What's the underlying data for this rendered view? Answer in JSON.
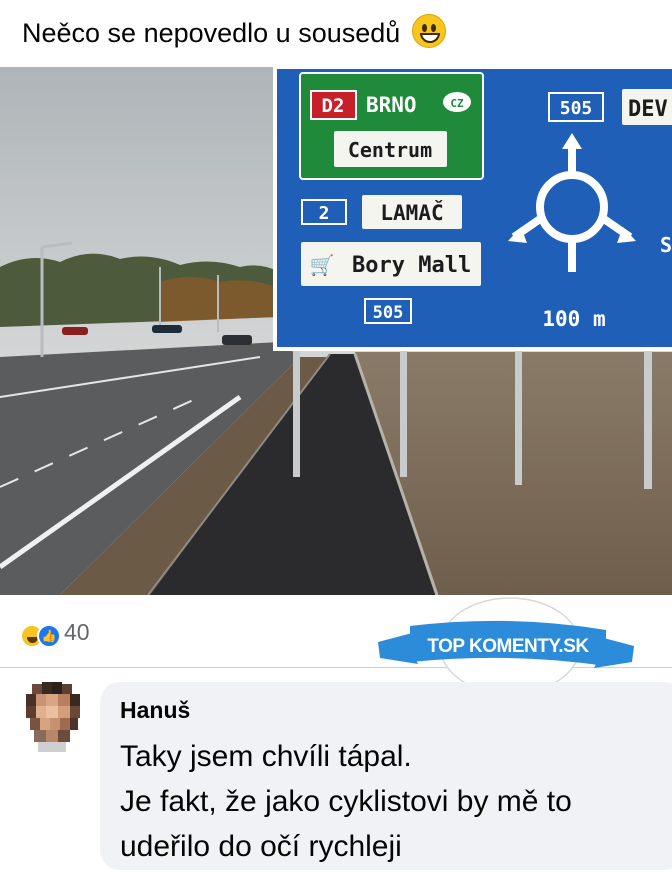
{
  "post": {
    "text": "Neěco se nepovedlo u sousedů",
    "emoji": "grinning-face-emoji"
  },
  "photo": {
    "sign": {
      "d2_badge": "D2",
      "destination_1": "BRNO",
      "country_badge": "CZ",
      "destination_2": "Centrum",
      "route_badge_2": "2",
      "destination_3": "LAMAČ",
      "destination_4": "Bory Mall",
      "route_badge_505_left": "505",
      "route_badge_505_top": "505",
      "cut_off_destination": "DEV",
      "cut_off_letter": "S",
      "distance": "100 m",
      "colors": {
        "blue": "#1f5fb7",
        "green": "#1e8a3a",
        "border": "#ffffff",
        "badge_red": "#c8202a"
      }
    }
  },
  "reactions": {
    "icons": [
      "haha-icon",
      "like-icon"
    ],
    "count": "40"
  },
  "watermark": {
    "text": "TOP KOMENTY.SK",
    "color": "#2c8cd9"
  },
  "comment": {
    "author": "Hanuš",
    "lines": [
      "Taky jsem chvíli tápal.",
      "Je fakt, že jako cyklistovi by mě to",
      "udeřilo do očí rychleji"
    ]
  }
}
